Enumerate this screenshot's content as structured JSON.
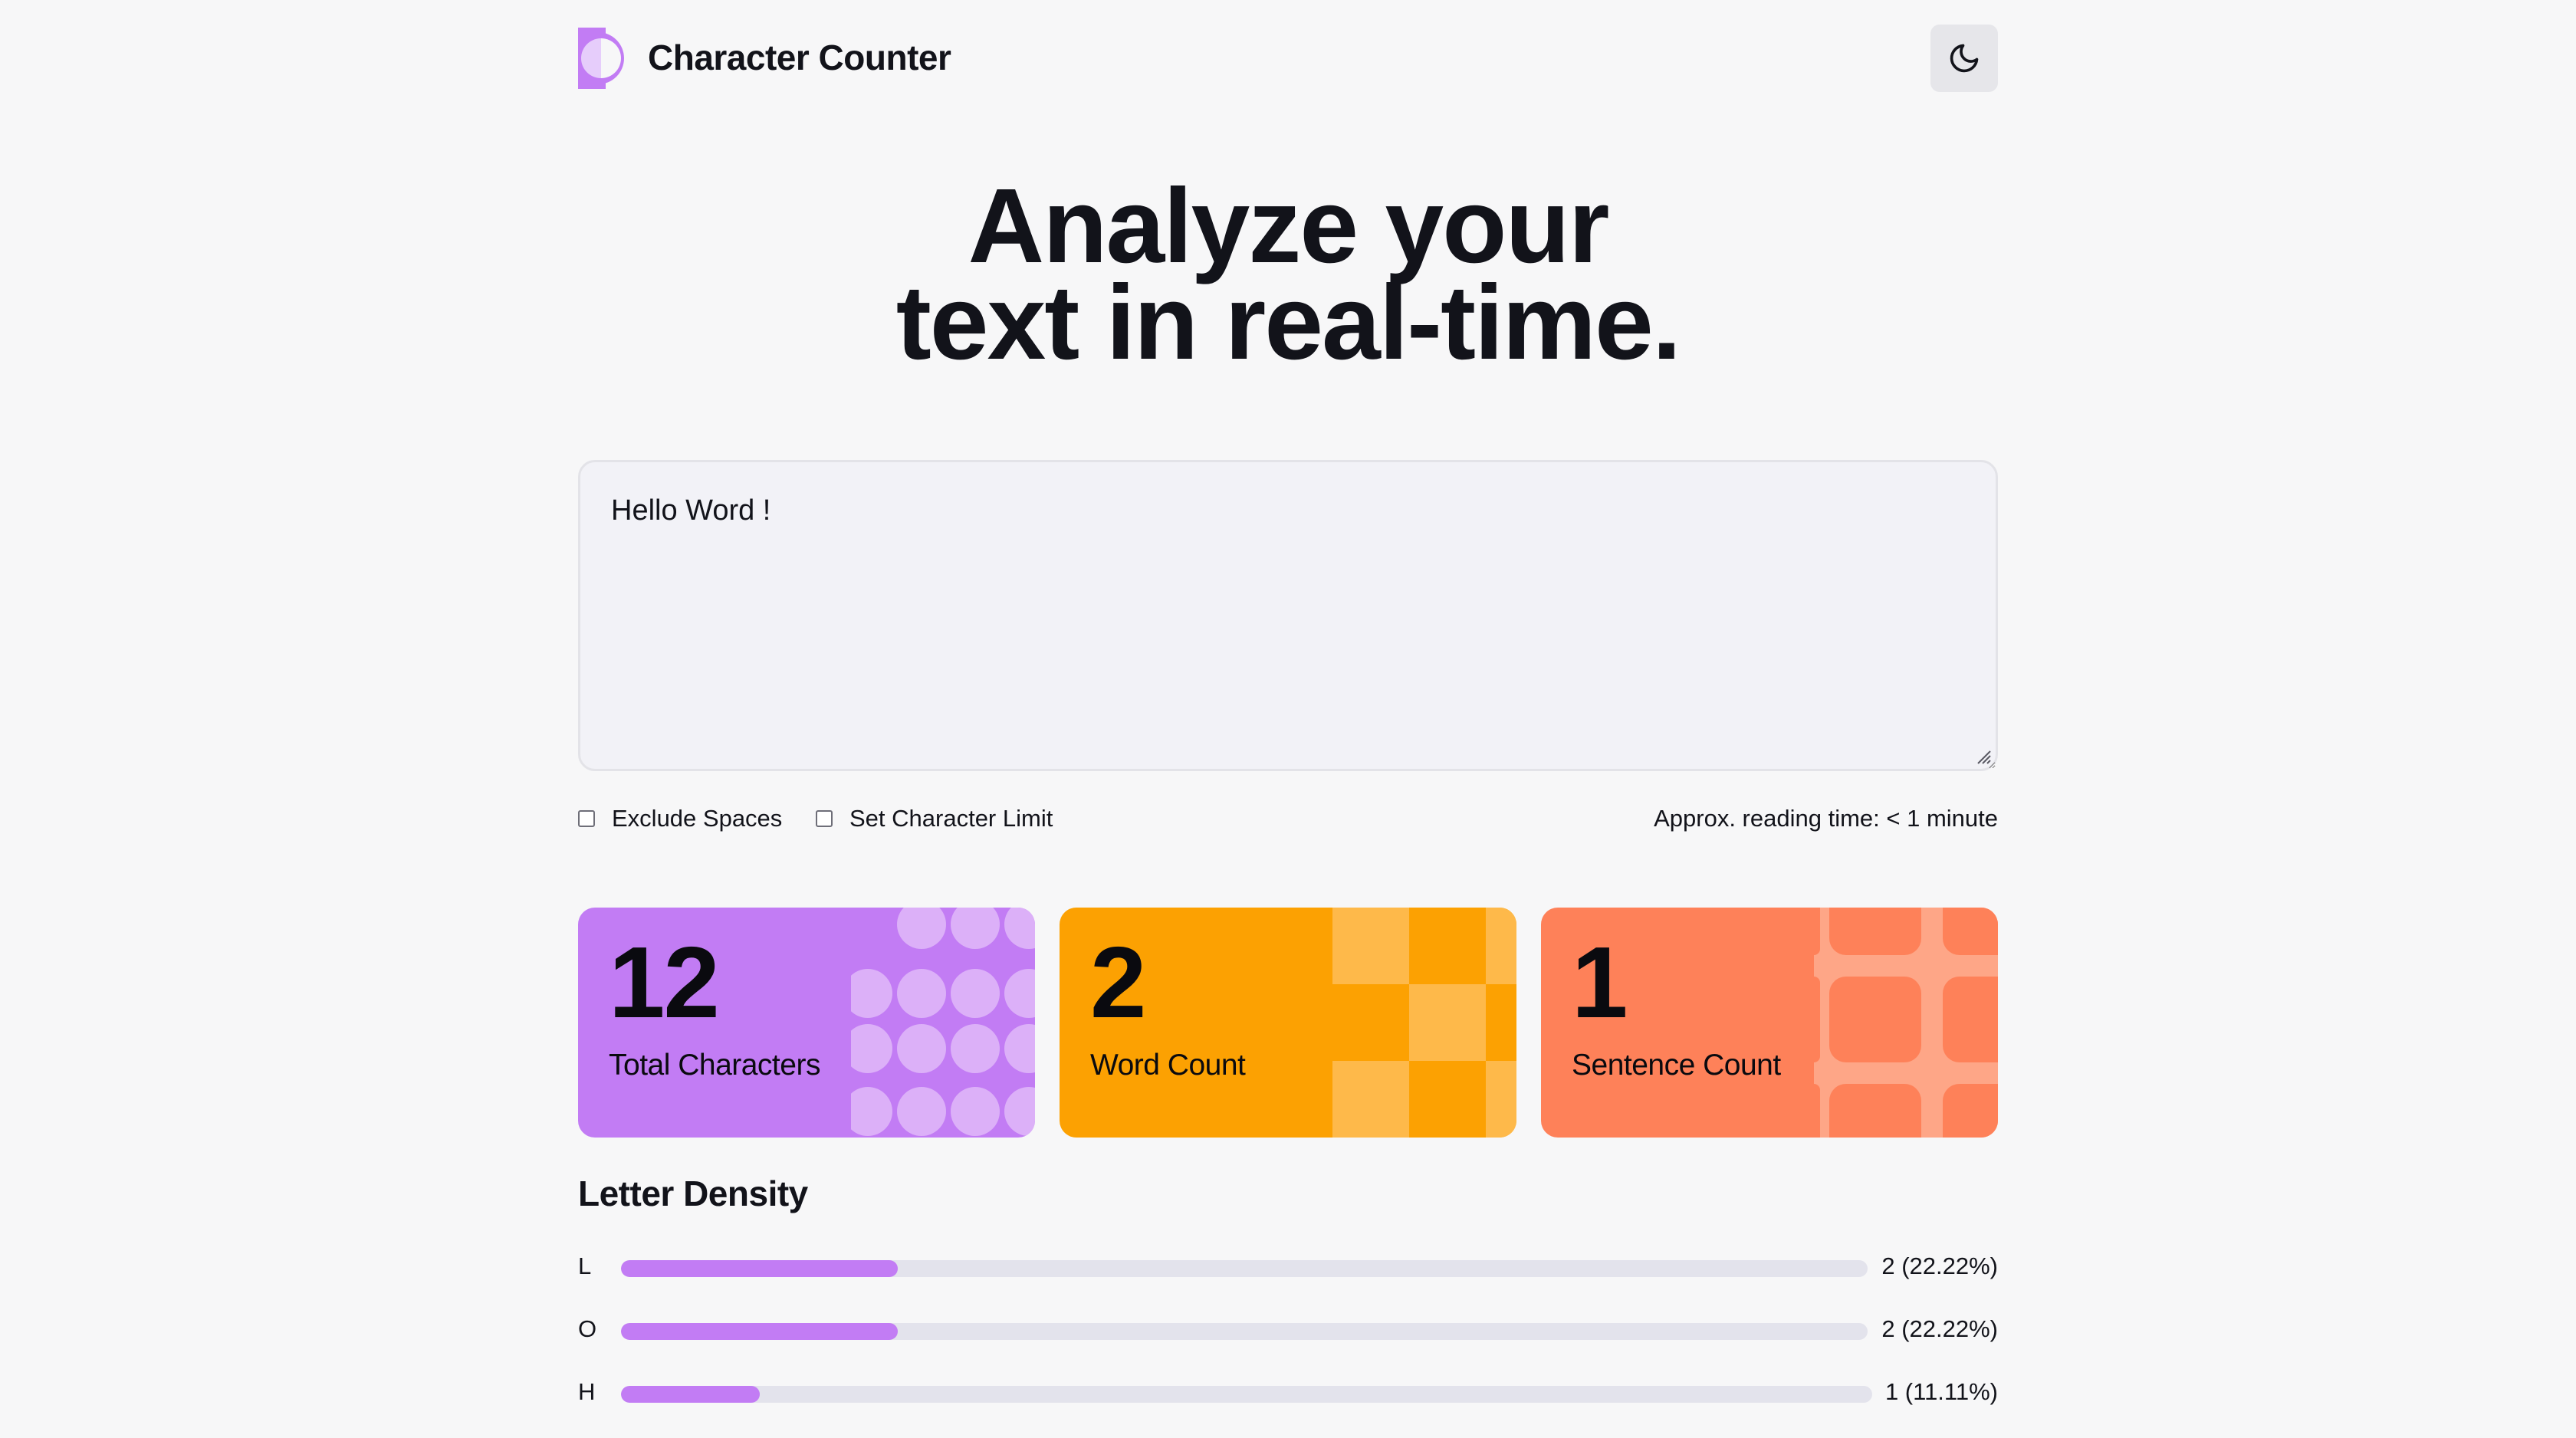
{
  "app": {
    "title": "Character Counter",
    "logo_icon": "half-circle-logo-icon",
    "theme_icon": "moon-icon",
    "accent_color": "#c27cf4"
  },
  "hero": {
    "line1": "Analyze your",
    "line2": "text in real-time."
  },
  "editor": {
    "value": "Hello Word !",
    "placeholder": ""
  },
  "options": {
    "exclude_spaces": {
      "label": "Exclude Spaces",
      "checked": false
    },
    "char_limit": {
      "label": "Set Character Limit",
      "checked": false
    },
    "reading_time": "Approx. reading time: < 1 minute"
  },
  "stats": {
    "total_characters": {
      "value": "12",
      "label": "Total Characters",
      "color": "#c27cf4"
    },
    "word_count": {
      "value": "2",
      "label": "Word Count",
      "color": "#fca102"
    },
    "sentence_count": {
      "value": "1",
      "label": "Sentence Count",
      "color": "#fe8159"
    }
  },
  "density": {
    "title": "Letter Density",
    "rows": [
      {
        "letter": "L",
        "value": "2 (22.22%)",
        "fraction": 0.2222
      },
      {
        "letter": "O",
        "value": "2 (22.22%)",
        "fraction": 0.2222
      },
      {
        "letter": "H",
        "value": "1 (11.11%)",
        "fraction": 0.1111
      }
    ]
  }
}
